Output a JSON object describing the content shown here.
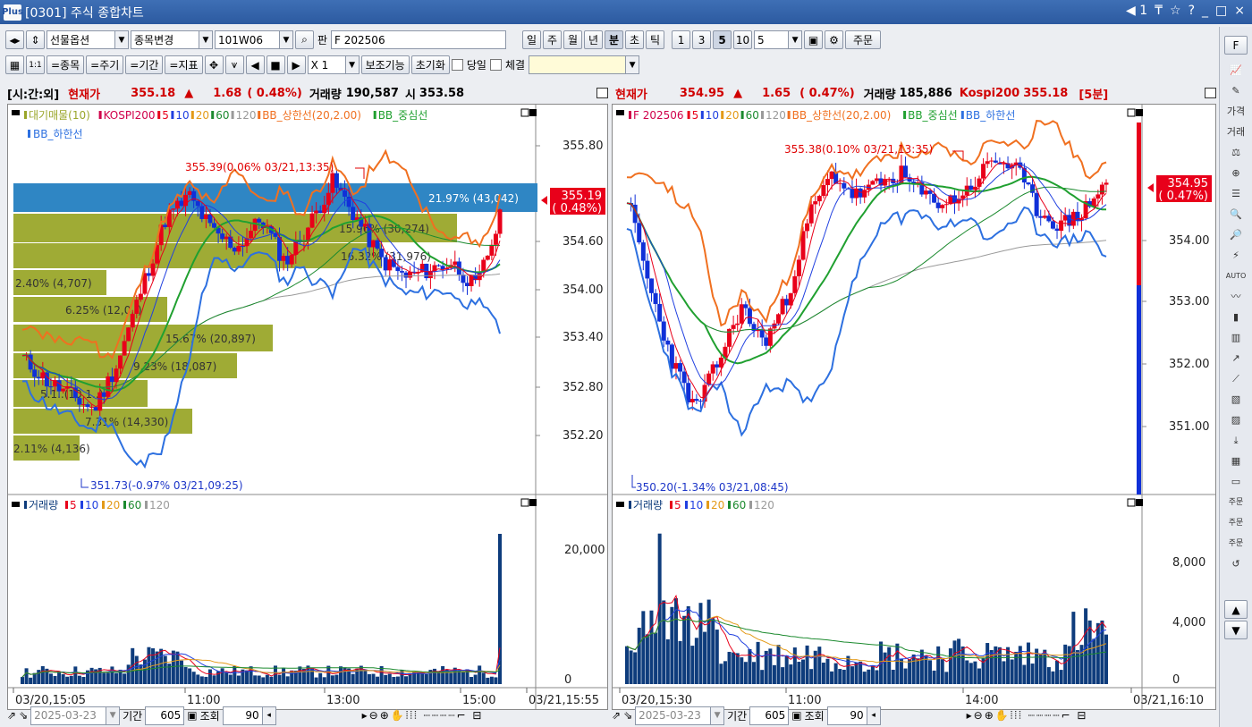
{
  "window": {
    "app_logo": "Plus",
    "title": "[0301] 주식 종합차트",
    "right_icons": [
      "◀ 1",
      "₸",
      "☆",
      "?",
      "_",
      "□",
      "×"
    ]
  },
  "toolbar1": {
    "combo_market": "선물옵션",
    "combo_change": "종목변경",
    "code": "101W06",
    "pan_label": "판",
    "name": "F 202506",
    "periods": [
      "일",
      "주",
      "월",
      "년",
      "분",
      "초",
      "틱"
    ],
    "active_period": "분",
    "intervals": [
      "1",
      "3",
      "5",
      "10"
    ],
    "active_interval": "5",
    "interval_value": "5",
    "order_button": "주문"
  },
  "toolbar2": {
    "btn_stock": "=종목",
    "btn_cycle": "=주기",
    "btn_period": "=기간",
    "btn_indicator": "=지표",
    "multiplier": "X 1",
    "btn_aux": "보조기능",
    "btn_reset": "초기화",
    "chk_today": "당일",
    "chk_trade": "체결"
  },
  "left_info": {
    "label": "[시:간:외]",
    "price_label": "현재가",
    "price": "355.18",
    "arrow": "▲",
    "change": "1.68",
    "rate": "( 0.48%)",
    "volume_label": "거래량",
    "volume": "190,587",
    "open_label": "시",
    "open": "353.58"
  },
  "right_info": {
    "price_label": "현재가",
    "price": "354.95",
    "arrow": "▲",
    "change": "1.65",
    "rate": "( 0.47%)",
    "volume_label": "거래량",
    "volume": "185,886",
    "kospi_label": "Kospi200",
    "kospi": "355.18",
    "cycle": "[5분]"
  },
  "left_chart": {
    "legend1": [
      "대기매물(10)",
      "KOSPI200",
      "5",
      "10",
      "20",
      "60",
      "120",
      "BB_상한선(20,2.00)",
      "BB_중심선"
    ],
    "legend2": "BB_하한선",
    "y_ticks": [
      "355.80",
      "355.19",
      "354.60",
      "354.00",
      "353.40",
      "352.80",
      "352.20"
    ],
    "cur_price": "355.19",
    "cur_rate": "( 0.48%)",
    "high_note": "355.39(0.06% 03/21,13:35)",
    "low_note": "351.73(-0.97% 03/21,09:25)",
    "profile_labels": [
      "21.97% (43,042)",
      "15.96% (30,274)",
      "16.32% (31,976)",
      "2.40% (4,707)",
      "6.25% (12,0..)",
      "15.67% (20,897)",
      "9.23% (18,087)",
      "5.1..(10,1..)",
      "7.31% (14,330)",
      "2.11% (4,136)"
    ],
    "vol_legend": [
      "거래량",
      "5",
      "10",
      "20",
      "60",
      "120"
    ],
    "vol_ticks": [
      "20,000",
      "0"
    ],
    "x_labels": [
      "03/20,15:05",
      "11:00",
      "13:00",
      "15:00",
      "03/21,15:55"
    ]
  },
  "right_chart": {
    "legend1": [
      "F 202506",
      "5",
      "10",
      "20",
      "60",
      "120",
      "BB_상한선(20,2.00)",
      "BB_중심선",
      "BB_하한선"
    ],
    "y_ticks": [
      "354.00",
      "353.00",
      "352.00",
      "351.00"
    ],
    "cur_price": "354.95",
    "cur_rate": "( 0.47%)",
    "high_note": "355.38(0.10% 03/21,13:35)",
    "low_note": "350.20(-1.34% 03/21,08:45)",
    "vol_legend": [
      "거래량",
      "5",
      "10",
      "20",
      "60",
      "120"
    ],
    "vol_ticks": [
      "8,000",
      "4,000",
      "0"
    ],
    "x_labels": [
      "03/20,15:30",
      "11:00",
      "14:00",
      "03/21,16:10"
    ]
  },
  "bottom_left": {
    "date": "2025-03-23",
    "period_label": "기간",
    "period": "605",
    "query_label": "조회",
    "count": "90"
  },
  "bottom_right": {
    "date": "2025-03-23",
    "period_label": "기간",
    "period": "605",
    "query_label": "조회",
    "count": "90"
  },
  "sidebar": {
    "top_button": "F",
    "items": [
      "가격",
      "거래",
      "AUTO",
      "주문",
      "주문",
      "주문"
    ]
  },
  "colors": {
    "up": "#e8001a",
    "down": "#1030d8",
    "ma5": "#e8001a",
    "ma10": "#2040e0",
    "ma20": "#e39a17",
    "ma60": "#1b8a2e",
    "ma120": "#9a9a9a",
    "bb_upper": "#f07020",
    "bb_mid": "#20a030",
    "bb_lower": "#2d70e0",
    "profile": "#9aa62a",
    "profile_top": "#2f86c4",
    "volume": "#0e3c7c"
  }
}
